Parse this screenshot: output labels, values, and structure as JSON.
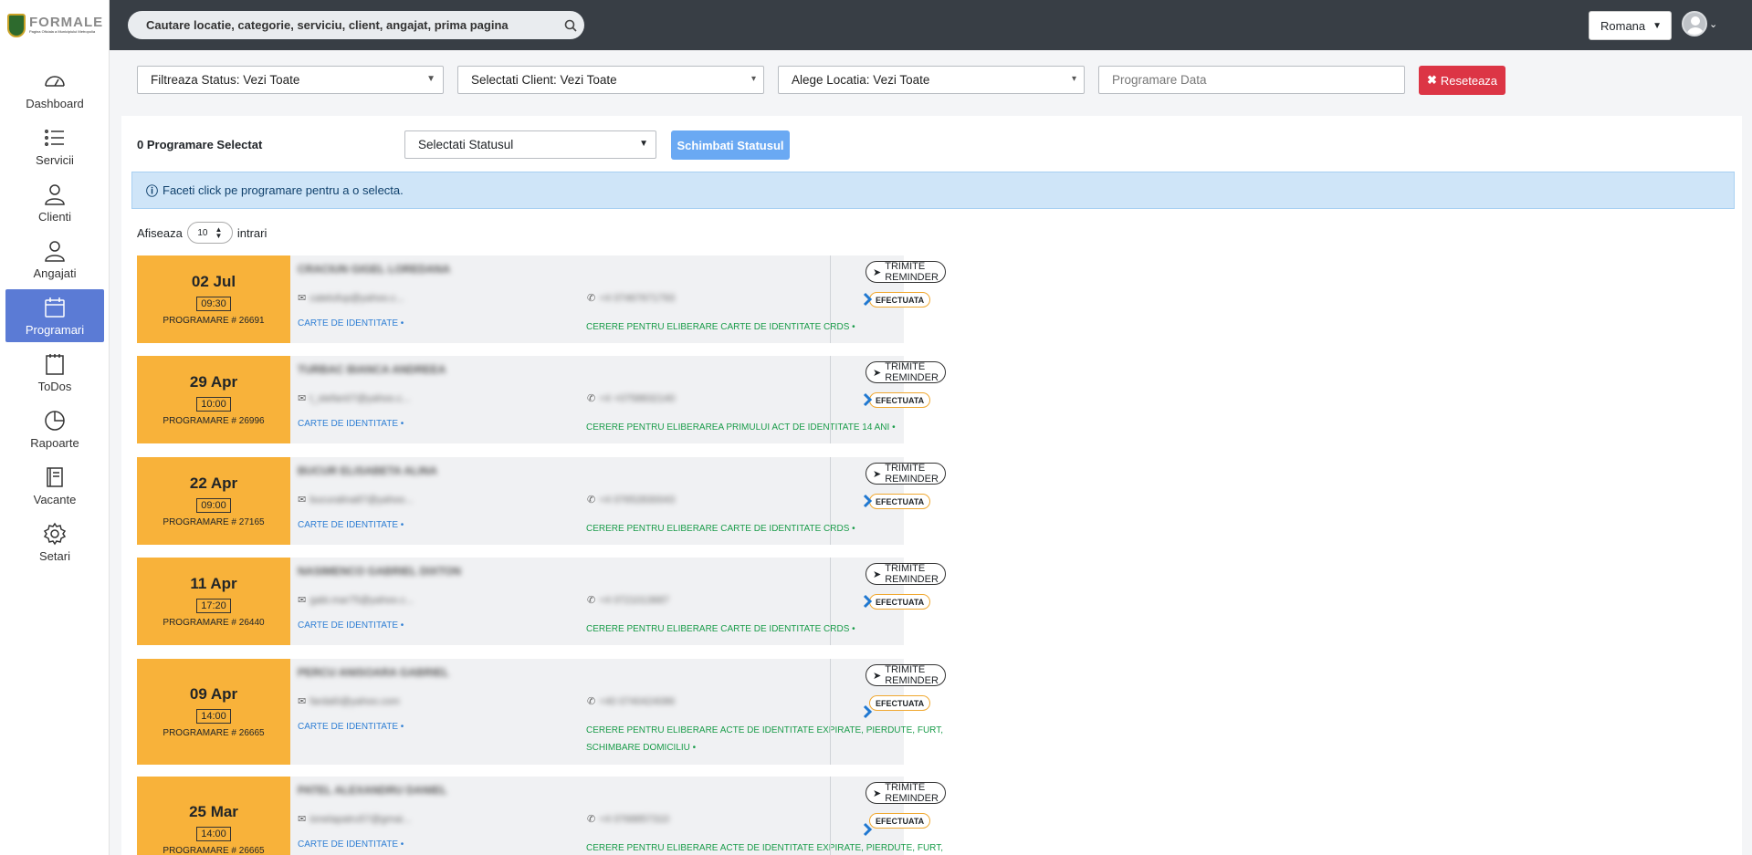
{
  "app": {
    "logo_text": "FORMALE",
    "logo_subtitle": "Pagina Oficiala a Municipiului Metropolia",
    "language": "Romana"
  },
  "search": {
    "placeholder": "Cautare locatie, categorie, serviciu, client, angajat, prima pagina"
  },
  "sidebar": {
    "items": [
      {
        "label": "Dashboard",
        "icon": "gauge-icon"
      },
      {
        "label": "Servicii",
        "icon": "list-icon"
      },
      {
        "label": "Clienti",
        "icon": "person-icon"
      },
      {
        "label": "Angajati",
        "icon": "person-icon"
      },
      {
        "label": "Programari",
        "icon": "calendar-icon",
        "active": true
      },
      {
        "label": "ToDos",
        "icon": "notepad-icon"
      },
      {
        "label": "Rapoarte",
        "icon": "pie-chart-icon"
      },
      {
        "label": "Vacante",
        "icon": "book-icon"
      },
      {
        "label": "Setari",
        "icon": "gear-icon"
      }
    ]
  },
  "filters": {
    "status": "Filtreaza Status: Vezi Toate",
    "client": "Selectati Client: Vezi Toate",
    "location": "Alege Locatia: Vezi Toate",
    "date_placeholder": "Programare Data",
    "reset": "Reseteaza"
  },
  "bulk": {
    "selected_count": "0 Programare Selectat",
    "status_select": "Selectati Statusul",
    "change_button": "Schimbati Statusul"
  },
  "info_message": "Faceti click pe programare pentru a o selecta.",
  "entries": {
    "prefix": "Afiseaza",
    "value": "10",
    "suffix": "intrari"
  },
  "appointments": [
    {
      "date": "02 Jul",
      "time": "09:30",
      "number": "PROGRAMARE # 26691",
      "name": "CRACIUN GIGEL LOREDANA",
      "email": "catelufup@yahoo.c...",
      "phone": "+4 07467671793",
      "document": "CARTE DE IDENTITATE •",
      "service": "CERERE PENTRU ELIBERARE CARTE DE IDENTITATE CRDS •",
      "reminder": "TRIMITE REMINDER",
      "status": "EFECTUATA"
    },
    {
      "date": "29 Apr",
      "time": "10:00",
      "number": "PROGRAMARE # 26996",
      "name": "TURBAC BIANCA ANDREEA",
      "email": "t_stefan07@yahoo.c...",
      "phone": "+4 +0758832140",
      "document": "CARTE DE IDENTITATE •",
      "service": "CERERE PENTRU ELIBERAREA PRIMULUI ACT DE IDENTITATE 14 ANI •",
      "reminder": "TRIMITE REMINDER",
      "status": "EFECTUATA"
    },
    {
      "date": "22 Apr",
      "time": "09:00",
      "number": "PROGRAMARE # 27165",
      "name": "BUCUR ELISABETA ALINA",
      "email": "bucuralina87@yahoo...",
      "phone": "+4 07652830043",
      "document": "CARTE DE IDENTITATE •",
      "service": "CERERE PENTRU ELIBERARE CARTE DE IDENTITATE CRDS •",
      "reminder": "TRIMITE REMINDER",
      "status": "EFECTUATA"
    },
    {
      "date": "11 Apr",
      "time": "17:20",
      "number": "PROGRAMARE # 26440",
      "name": "NASIMENCO GABRIEL DIXTON",
      "email": "gabi.mar75@yahoo.c...",
      "phone": "+4 0721013687",
      "document": "CARTE DE IDENTITATE •",
      "service": "CERERE PENTRU ELIBERARE CARTE DE IDENTITATE CRDS •",
      "reminder": "TRIMITE REMINDER",
      "status": "EFECTUATA"
    },
    {
      "date": "09 Apr",
      "time": "14:00",
      "number": "PROGRAMARE # 26665",
      "name": "PERCU ANISOARA GABRIEL",
      "email": "fardal0@yahoo.com",
      "phone": "+40 0740424086",
      "document": "CARTE DE IDENTITATE •",
      "service": "CERERE PENTRU ELIBERARE ACTE DE IDENTITATE EXPIRATE, PIERDUTE, FURT, SCHIMBARE DOMICILIU •",
      "reminder": "TRIMITE REMINDER",
      "status": "EFECTUATA"
    },
    {
      "date": "25 Mar",
      "time": "14:00",
      "number": "PROGRAMARE # 26665",
      "name": "PATEL ALEXANDRU DANIEL",
      "email": "ionelapatru57@gmai...",
      "phone": "+4 0768857310",
      "document": "CARTE DE IDENTITATE •",
      "service": "CERERE PENTRU ELIBERARE ACTE DE IDENTITATE EXPIRATE, PIERDUTE, FURT, SCHIMBARE",
      "reminder": "TRIMITE REMINDER",
      "status": "EFECTUATA"
    }
  ]
}
